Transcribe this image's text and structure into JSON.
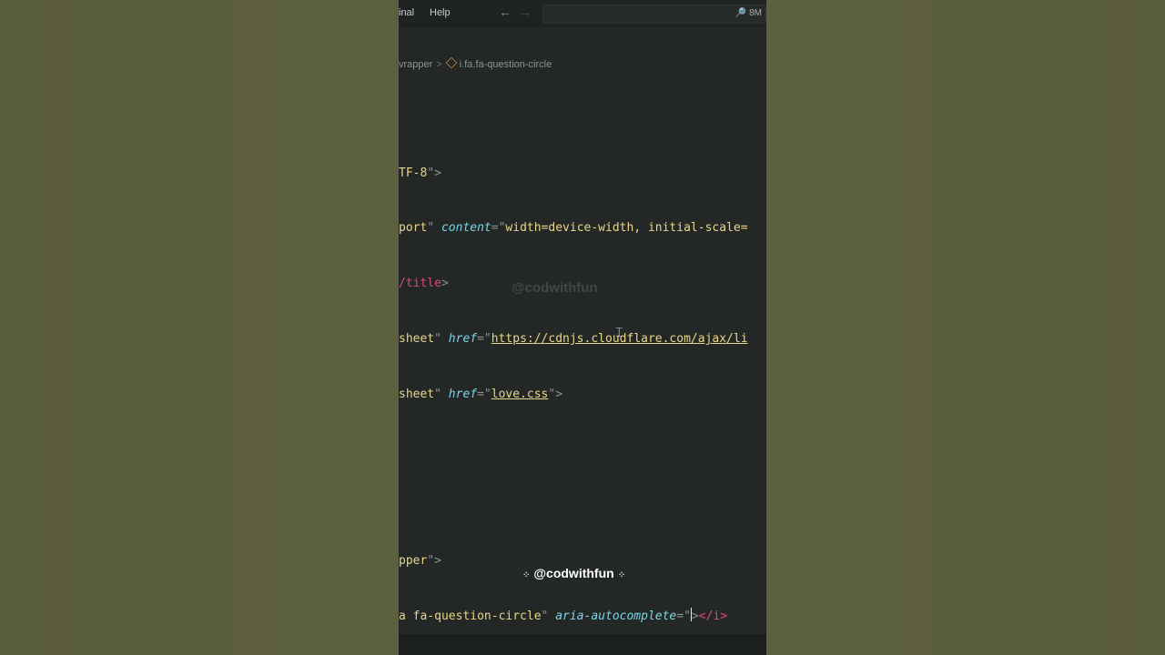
{
  "menubar": {
    "items": [
      "inal",
      "Help"
    ],
    "nav_back": "←",
    "nav_forward": "→",
    "search_label": "🔎 8M"
  },
  "breadcrumb": {
    "parent": "vrapper",
    "separator": ">",
    "current": "i.fa.fa-question-circle"
  },
  "code": {
    "line1": {
      "val": "TF-8",
      "close": "\">"
    },
    "line2": {
      "val": "port",
      "attr": "content",
      "eq": "=\"",
      "value": "width=device-width, initial-scale="
    },
    "line3": {
      "tag": "/title",
      "close": ">"
    },
    "line4": {
      "val": "sheet",
      "attr": "href",
      "eq": "=\"",
      "value": "https://cdnjs.cloudflare.com/ajax/li"
    },
    "line5": {
      "val": "sheet",
      "attr": "href",
      "eq": "=\"",
      "value": "love.css",
      "close": "\">"
    },
    "line6": {
      "val": "pper",
      "close": "\">"
    },
    "line7": {
      "prefix": "a",
      "val": " fa-question-circle",
      "q": "\"",
      "attr": "aria-autocomplete",
      "eq": "=\"",
      "close_angle": ">",
      "end_tag": "</i>"
    }
  },
  "watermark_center": "@codwithfun",
  "overlay_handle": "@codwithfun"
}
